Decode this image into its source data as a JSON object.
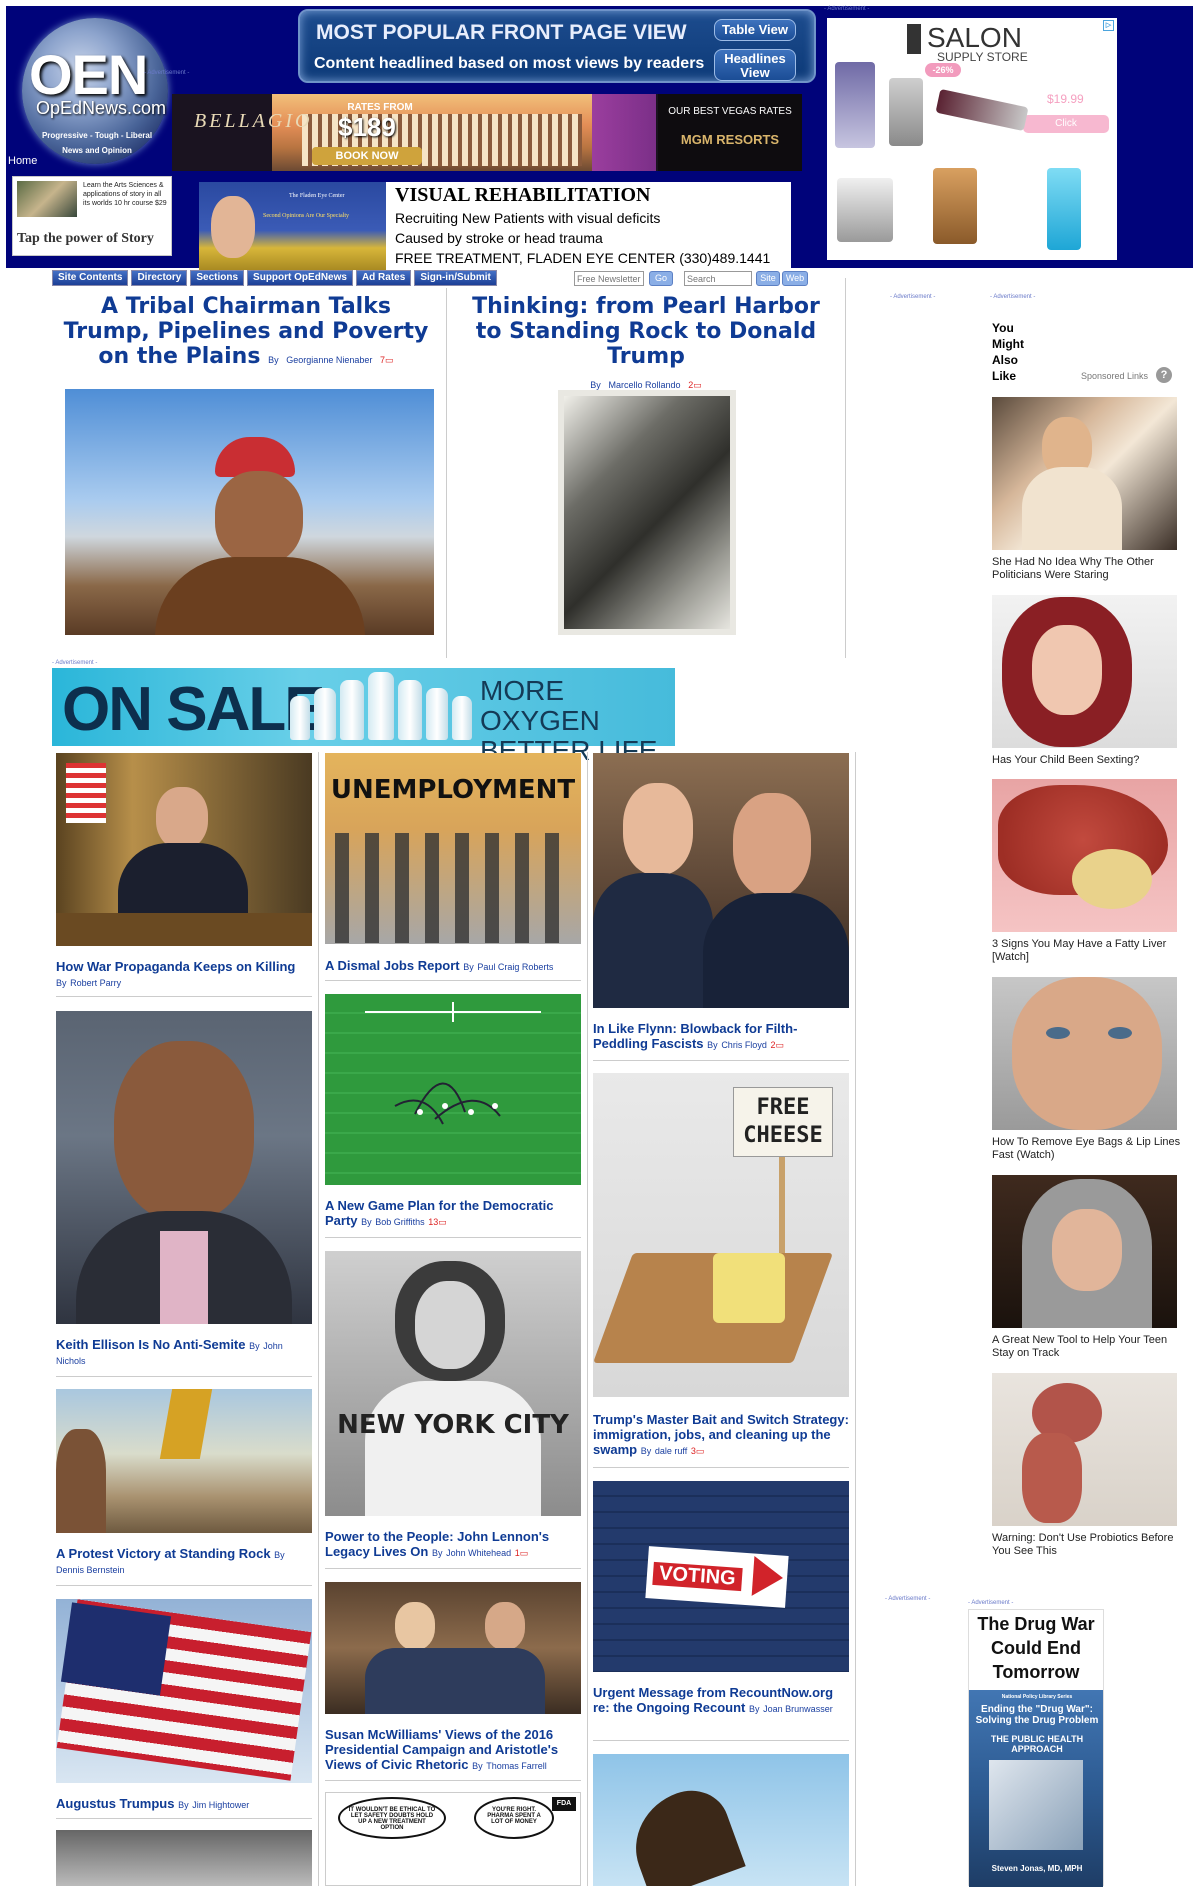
{
  "header": {
    "logo": {
      "name": "OEN",
      "site": "OpEdNews.com",
      "tagline_1": "Progressive - Tough - Liberal",
      "tagline_2": "News and Opinion"
    },
    "home_link": "Home",
    "popular": {
      "title": "MOST POPULAR FRONT PAGE VIEW",
      "subtitle": "Content headlined based on most views by readers",
      "table_view": "Table View",
      "headlines_view": "Headlines View"
    },
    "ad_label": "- Advertisement -"
  },
  "ads": {
    "bellagio": {
      "logo": "BELLAGIO",
      "rates_from": "RATES FROM",
      "price": "$189",
      "book": "BOOK NOW",
      "best_rates": "OUR BEST VEGAS RATES",
      "mgm": "MGM RESORTS"
    },
    "tap_story": {
      "text": "Learn the Arts Sciences & applications of story in all its worlds 10 hr course $29",
      "tagline": "Tap the power of Story"
    },
    "visual_rehab": {
      "small": "The Fladen Eye Center",
      "small2": "Second Opinions Are Our Specialty",
      "headline": "VISUAL REHABILITATION",
      "line1": "Recruiting New Patients with visual deficits",
      "line2": "Caused by stroke or head trauma",
      "line3": "FREE TREATMENT,   FLADEN EYE CENTER  (330)489.1441"
    },
    "salon": {
      "brand": "SALON",
      "sub": "SUPPLY STORE",
      "discount": "-26%",
      "price": "$19.99",
      "click": "Click"
    },
    "onsale": {
      "left": "ON SALE",
      "right_1": "MORE OXYGEN",
      "right_2": "BETTER LIFE"
    },
    "drug_war": {
      "title": "The Drug War Could End Tomorrow",
      "series": "National Policy Library Series",
      "sub": "Ending the \"Drug War\": Solving the Drug Problem",
      "book": "THE PUBLIC HEALTH APPROACH",
      "author": "Steven Jonas, MD, MPH"
    }
  },
  "nav": {
    "items": [
      "Site Contents",
      "Directory",
      "Sections",
      "Support OpEdNews",
      "Ad Rates",
      "Sign-in/Submit"
    ],
    "newsletter_placeholder": "Free Newsletter",
    "go": "Go",
    "search_placeholder": "Search",
    "site": "Site",
    "web": "Web"
  },
  "featured": [
    {
      "title": "A Tribal Chairman Talks Trump, Pipelines and Poverty on the Plains",
      "by": "By",
      "author": "Georgianne Nienaber",
      "comments": "7"
    },
    {
      "title": "Thinking: from Pearl Harbor to Standing Rock to Donald Trump",
      "by": "By",
      "author": "Marcello Rollando",
      "comments": "2"
    }
  ],
  "articles": {
    "col1": [
      {
        "title": "How War Propaganda Keeps on Killing",
        "by": "By",
        "author": "Robert Parry",
        "comments": ""
      },
      {
        "title": "Keith Ellison Is No Anti-Semite",
        "by": "By",
        "author": "John Nichols",
        "comments": ""
      },
      {
        "title": "A Protest Victory at Standing Rock",
        "by": "By",
        "author": "Dennis Bernstein",
        "comments": ""
      },
      {
        "title": "Augustus Trumpus",
        "by": "By",
        "author": "Jim Hightower",
        "comments": ""
      }
    ],
    "col2": [
      {
        "title": "A Dismal Jobs Report",
        "by": "By",
        "author": "Paul Craig Roberts",
        "comments": "",
        "img_text": "UNEMPLOYMENT"
      },
      {
        "title": "A New Game Plan for the Democratic Party",
        "by": "By",
        "author": "Bob Griffiths",
        "comments": "13"
      },
      {
        "title": "Power to the People: John Lennon's Legacy Lives On",
        "by": "By",
        "author": "John Whitehead",
        "comments": "1",
        "img_text": "NEW YORK CITY"
      },
      {
        "title": "Susan McWilliams' Views of the 2016 Presidential Campaign and Aristotle's Views of Civic Rhetoric",
        "by": "By",
        "author": "Thomas Farrell",
        "comments": ""
      }
    ],
    "col3": [
      {
        "title": "In Like Flynn: Blowback for Filth-Peddling Fascists",
        "by": "By",
        "author": "Chris Floyd",
        "comments": "2"
      },
      {
        "title": "Trump's Master Bait and Switch Strategy: immigration, jobs, and cleaning up the swamp",
        "by": "By",
        "author": "dale ruff",
        "comments": "3",
        "img_text": "FREE CHEESE"
      },
      {
        "title": "Urgent Message from RecountNow.org re: the Ongoing Recount",
        "by": "By",
        "author": "Joan Brunwasser",
        "comments": "",
        "img_text": "VOTING"
      }
    ],
    "cartoon": {
      "bubble1": "IT WOULDN'T BE ETHICAL TO LET SAFETY DOUBTS HOLD UP A NEW TREATMENT OPTION",
      "bubble2": "YOU'RE RIGHT. PHARMA SPENT A LOT OF MONEY",
      "badge": "FDA"
    }
  },
  "sidebar": {
    "heading": "You Might Also Like",
    "sponsored": "Sponsored Links",
    "help": "?",
    "items": [
      {
        "caption": "She Had No Idea Why The Other Politicians Were Staring"
      },
      {
        "caption": "Has Your Child Been Sexting?"
      },
      {
        "caption": "3 Signs You May Have a Fatty Liver [Watch]"
      },
      {
        "caption": "How To Remove Eye Bags & Lip Lines Fast (Watch)"
      },
      {
        "caption": "A Great New Tool to Help Your Teen Stay on Track"
      },
      {
        "caption": "Warning: Don't Use Probiotics Before You See This"
      }
    ]
  }
}
